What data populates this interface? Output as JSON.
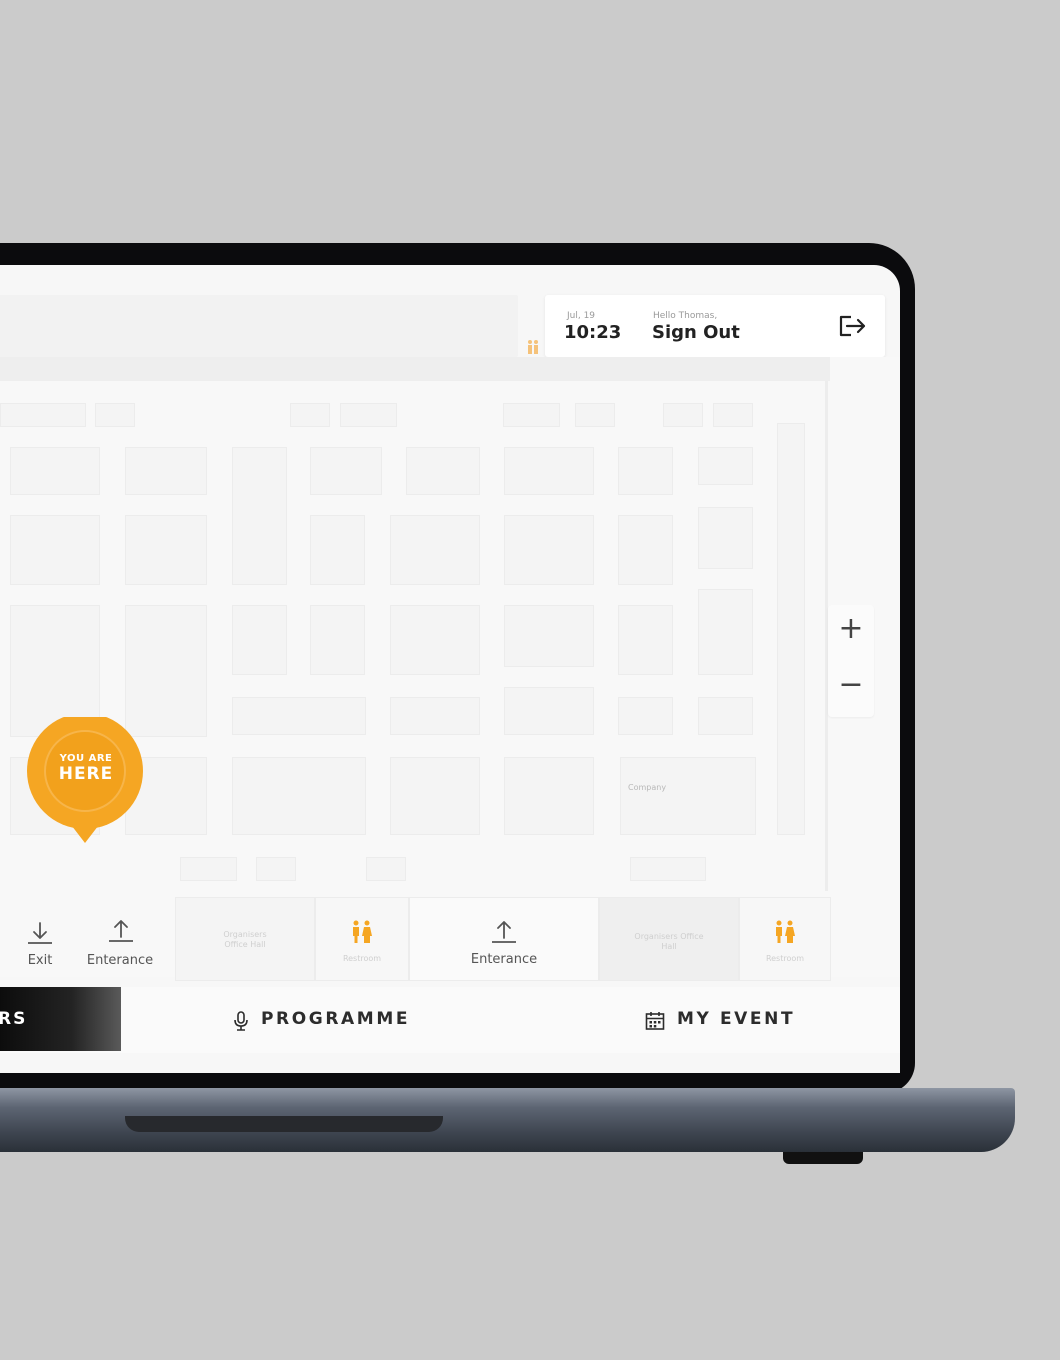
{
  "header": {
    "date": "Jul, 19",
    "time": "10:23",
    "greeting": "Hello Thomas,",
    "sign_out_label": "Sign Out"
  },
  "map": {
    "you_are_here_top": "YOU ARE",
    "you_are_here_bottom": "HERE",
    "booth_label": "Company",
    "zoom_in": "+",
    "zoom_out": "−",
    "accent_color": "#f5a623"
  },
  "facilities": [
    {
      "label": "Exit",
      "icon": "download-arrow-icon"
    },
    {
      "label": "Enterance",
      "icon": "upload-arrow-icon"
    },
    {
      "label": "Organisers Office Hall",
      "icon": ""
    },
    {
      "label": "Restroom",
      "icon": "restroom-icon"
    },
    {
      "label": "Enterance",
      "icon": "upload-arrow-icon"
    },
    {
      "label": "Organisers Office Hall",
      "icon": ""
    },
    {
      "label": "Restroom",
      "icon": "restroom-icon"
    }
  ],
  "nav": {
    "active_partial": "RS",
    "programme": "PROGRAMME",
    "my_event": "MY EVENT"
  }
}
